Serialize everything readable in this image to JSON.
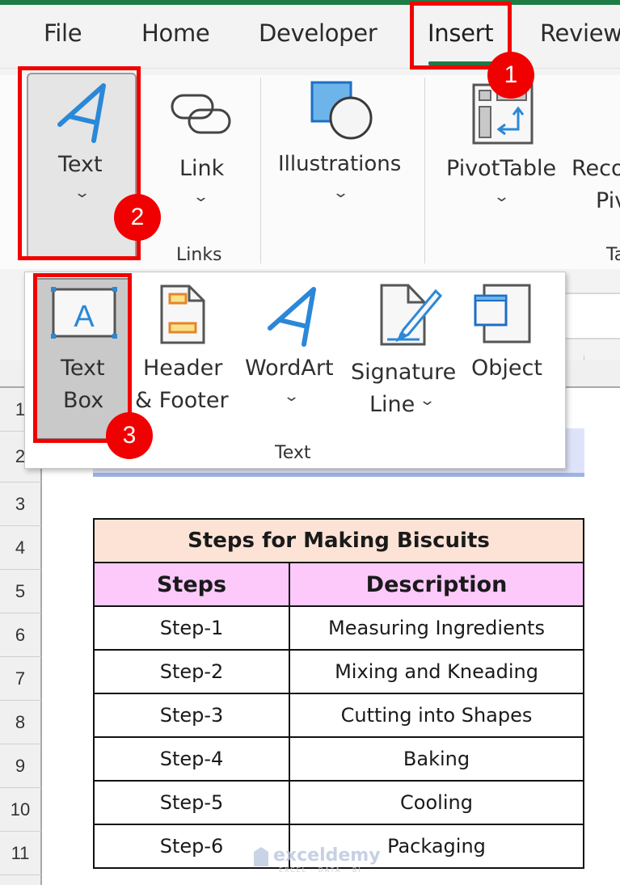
{
  "ribbon_tabs": [
    {
      "label": "File"
    },
    {
      "label": "Home"
    },
    {
      "label": "Developer"
    },
    {
      "label": "Insert",
      "active": true
    },
    {
      "label": "Review"
    }
  ],
  "ribbon": {
    "text_button": {
      "label": "Text",
      "icon": "text-a-icon"
    },
    "link_button": {
      "label": "Link",
      "icon": "link-icon"
    },
    "links_group_label": "Links",
    "illustrations_button": {
      "label": "Illustrations",
      "icon": "shapes-icon"
    },
    "pivottable_button": {
      "label": "PivotTable",
      "icon": "pivottable-icon"
    },
    "recommended_pivot_button": {
      "label_line1": "Reco",
      "label_line2": "Piv"
    },
    "tables_group_label": "Ta"
  },
  "text_dropdown": {
    "group_label": "Text",
    "items": [
      {
        "label_line1": "Text",
        "label_line2": "Box",
        "icon": "textbox-icon"
      },
      {
        "label_line1": "Header",
        "label_line2": "& Footer",
        "icon": "header-footer-icon"
      },
      {
        "label_line1": "WordArt",
        "icon": "wordart-icon",
        "has_dropdown": true
      },
      {
        "label_line1": "Signature",
        "label_line2": "Line",
        "icon": "signature-line-icon",
        "has_dropdown": true
      },
      {
        "label_line1": "Object",
        "icon": "object-icon"
      }
    ]
  },
  "annotations": {
    "badges": [
      "1",
      "2",
      "3"
    ],
    "highlight_color": "#f20000"
  },
  "sheet": {
    "row_numbers": [
      "1",
      "2",
      "3",
      "4",
      "5",
      "6",
      "7",
      "8",
      "9",
      "10",
      "11"
    ],
    "table": {
      "title": "Steps for Making Biscuits",
      "headers": [
        "Steps",
        "Description"
      ],
      "rows": [
        [
          "Step-1",
          "Measuring Ingredients"
        ],
        [
          "Step-2",
          "Mixing and Kneading"
        ],
        [
          "Step-3",
          "Cutting into Shapes"
        ],
        [
          "Step-4",
          "Baking"
        ],
        [
          "Step-5",
          "Cooling"
        ],
        [
          "Step-6",
          "Packaging"
        ]
      ]
    }
  },
  "watermark": {
    "name": "exceldemy",
    "tagline": "EXCEL · DATA · BI"
  },
  "colors": {
    "accent_green": "#1f7a43",
    "icon_blue": "#2b88d8",
    "title_fill": "#fce3d6",
    "header_fill": "#fdc9fb"
  }
}
